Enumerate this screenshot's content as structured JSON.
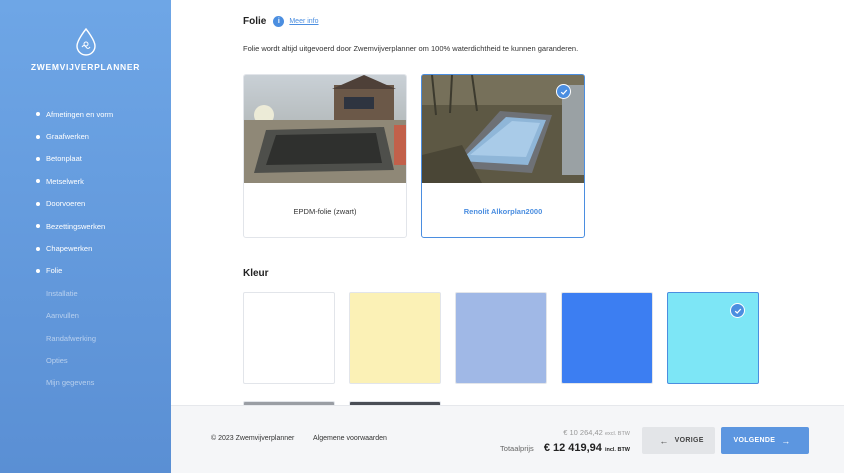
{
  "sidebar": {
    "brand": "ZWEMVIJVERPLANNER",
    "steps": [
      {
        "label": "Afmetingen en vorm",
        "status": "done"
      },
      {
        "label": "Graafwerken",
        "status": "done"
      },
      {
        "label": "Betonplaat",
        "status": "done"
      },
      {
        "label": "Metselwerk",
        "status": "done"
      },
      {
        "label": "Doorvoeren",
        "status": "done"
      },
      {
        "label": "Bezettingswerken",
        "status": "done"
      },
      {
        "label": "Chapewerken",
        "status": "done"
      },
      {
        "label": "Folie",
        "status": "done"
      },
      {
        "label": "Installatie",
        "status": "todo"
      },
      {
        "label": "Aanvullen",
        "status": "todo"
      },
      {
        "label": "Randafwerking",
        "status": "todo"
      },
      {
        "label": "Opties",
        "status": "todo"
      },
      {
        "label": "Mijn gegevens",
        "status": "todo"
      }
    ]
  },
  "main": {
    "title": "Folie",
    "info_link": "Meer info",
    "description": "Folie wordt altijd uitgevoerd door Zwemvijverplanner om 100% waterdichtheid te kunnen garanderen.",
    "options": [
      {
        "label": "EPDM-folie (zwart)",
        "selected": false
      },
      {
        "label": "Renolit Alkorplan2000",
        "selected": true
      }
    ],
    "colors_title": "Kleur",
    "colors": [
      {
        "hex": "#ffffff",
        "selected": false
      },
      {
        "hex": "#fbf1b6",
        "selected": false
      },
      {
        "hex": "#a0b8e6",
        "selected": false
      },
      {
        "hex": "#3c7ef2",
        "selected": false
      },
      {
        "hex": "#7de6f6",
        "selected": true
      }
    ],
    "colors_row2": [
      {
        "hex": "#9a9ea4"
      },
      {
        "hex": "#4a4e56"
      }
    ]
  },
  "footer": {
    "copyright": "© 2023 Zwemvijverplanner",
    "terms": "Algemene voorwaarden",
    "price_excl": "€ 10 264,42",
    "price_excl_suffix": "excl. BTW",
    "total_label": "Totaalprijs",
    "total_value": "€ 12 419,94",
    "total_suffix": "incl. BTW",
    "prev_label": "VORIGE",
    "next_label": "VOLGENDE"
  },
  "colors": {
    "accent": "#4b8ee0",
    "sidebar": "#6ea6e6"
  }
}
